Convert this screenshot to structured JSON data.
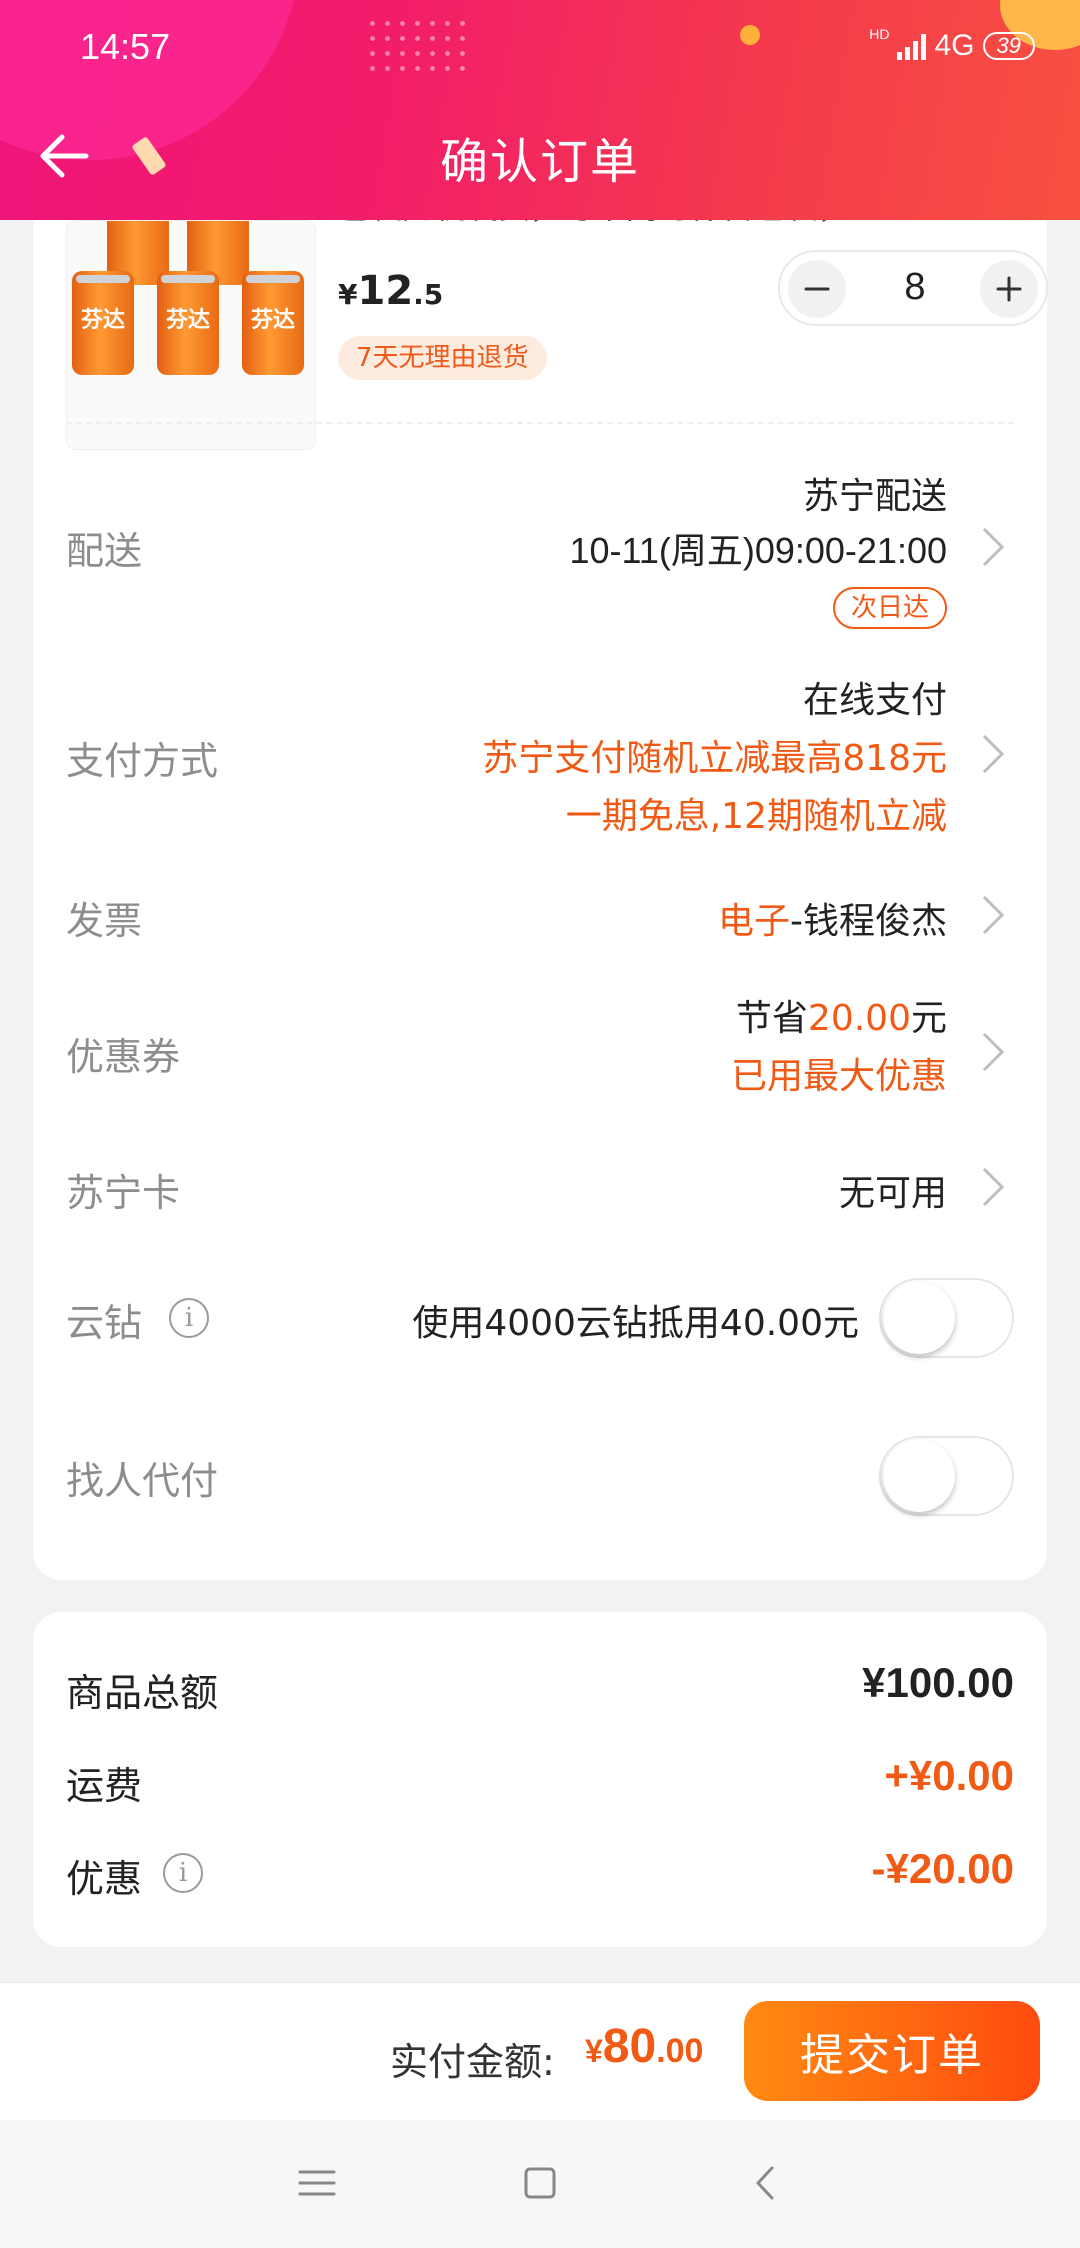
{
  "status_bar": {
    "time": "14:57",
    "network": "4G",
    "hd": "HD",
    "battery": "39"
  },
  "header": {
    "title": "确认订单",
    "back_icon": "back-arrow-icon"
  },
  "product": {
    "title_fragment": "色装随机发货，与下同时保留包装，和赠品",
    "image_label": "芬达",
    "price_symbol": "¥",
    "price_int": "12",
    "price_dec": ".5",
    "quantity": "8",
    "return_badge": "7天无理由退货"
  },
  "rows": {
    "delivery": {
      "label": "配送",
      "line1": "苏宁配送",
      "line2": "10-11(周五)09:00-21:00",
      "badge": "次日达"
    },
    "payment": {
      "label": "支付方式",
      "line1": "在线支付",
      "line2": "苏宁支付随机立减最高818元",
      "line3": "一期免息,12期随机立减"
    },
    "invoice": {
      "label": "发票",
      "type": "电子",
      "name": "-钱程俊杰"
    },
    "coupon": {
      "label": "优惠券",
      "save_prefix": "节省",
      "save_amount": "20.00",
      "save_suffix": "元",
      "note": "已用最大优惠"
    },
    "suning_card": {
      "label": "苏宁卡",
      "value": "无可用"
    },
    "yunzuan": {
      "label": "云钻",
      "info_icon": "i",
      "value": "使用4000云钻抵用40.00元",
      "toggle_on": false
    },
    "pay_for_me": {
      "label": "找人代付",
      "toggle_on": false
    }
  },
  "summary": {
    "goods_label": "商品总额",
    "goods_value": "¥100.00",
    "shipping_label": "运费",
    "shipping_value": "+¥0.00",
    "discount_label": "优惠",
    "discount_value": "-¥20.00",
    "info_icon": "i"
  },
  "bottom": {
    "pay_label": "实付金额:",
    "pay_symbol": "¥",
    "pay_int": "80",
    "pay_dec": ".00",
    "submit_label": "提交订单"
  },
  "colors": {
    "accent": "#f05a14",
    "header_start": "#f0147a",
    "header_end": "#f75040",
    "label_gray": "#8d8d8d"
  }
}
